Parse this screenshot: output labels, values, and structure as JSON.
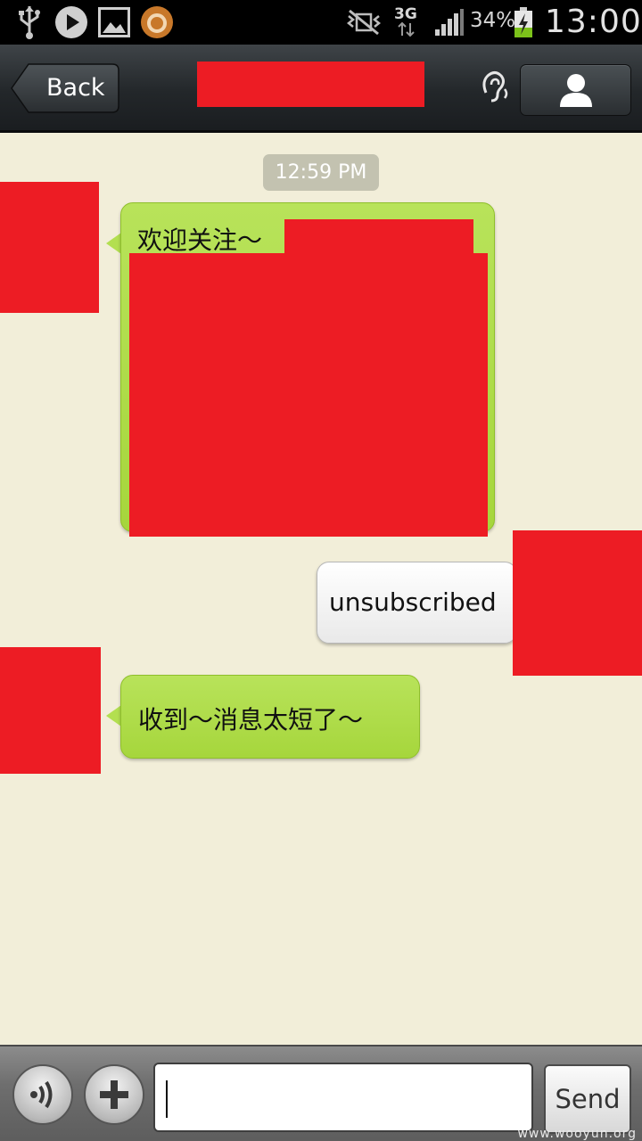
{
  "status_bar": {
    "network_type": "3G",
    "battery_percent": "34%",
    "time": "13:00",
    "icons": [
      "usb-icon",
      "play-icon",
      "gallery-icon",
      "app-notification-icon",
      "silent-vibrate-icon",
      "signal-icon",
      "battery-charging-icon"
    ]
  },
  "title_bar": {
    "back_label": "Back",
    "title": "[redacted]",
    "icons": [
      "earpiece-icon",
      "profile-icon"
    ]
  },
  "chat": {
    "timestamp": "12:59 PM",
    "messages": [
      {
        "side": "left",
        "text": "欢迎关注～",
        "color": "#a9d843",
        "content_redacted": true
      },
      {
        "side": "right",
        "text": "unsubscribed",
        "color": "#f2f2f2"
      },
      {
        "side": "left",
        "text": "收到～消息太短了～",
        "color": "#a9d843"
      }
    ]
  },
  "input_bar": {
    "input_value": "",
    "send_label": "Send",
    "icons": [
      "voice-icon",
      "plus-icon"
    ]
  },
  "watermark": "www.wooyun.org",
  "colors": {
    "redaction": "#ed1c24",
    "chat_background": "#f2eed9",
    "incoming_bubble": "#a9d843",
    "outgoing_bubble": "#f2f2f2"
  }
}
